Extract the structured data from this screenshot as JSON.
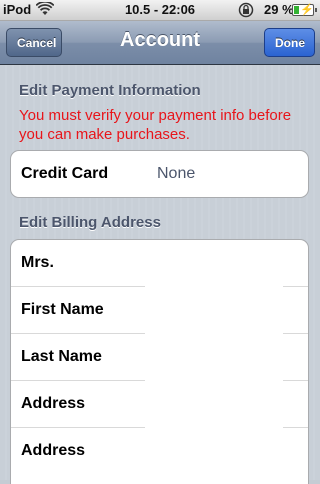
{
  "status_bar": {
    "carrier": "iPod",
    "time": "10.5 - 22:06",
    "battery_percent": "29 %",
    "battery_level": 0.29,
    "icons": [
      "wifi-icon",
      "lock-rotation-icon",
      "battery-charging-icon"
    ]
  },
  "nav": {
    "title": "Account",
    "cancel_label": "Cancel",
    "done_label": "Done"
  },
  "payment": {
    "header": "Edit Payment Information",
    "warning": "You must verify your payment info before you can make purchases.",
    "credit_card_label": "Credit Card",
    "credit_card_value": "None"
  },
  "billing": {
    "header": "Edit Billing Address",
    "fields": [
      {
        "label": "Mrs.",
        "value": ""
      },
      {
        "label": "First Name",
        "value": ""
      },
      {
        "label": "Last Name",
        "value": ""
      },
      {
        "label": "Address",
        "value": ""
      },
      {
        "label": "Address",
        "value": ""
      }
    ]
  },
  "colors": {
    "warning": "#e8151b",
    "nav_done": "#2a63d1",
    "nav_bar": "#7c8ea9"
  }
}
